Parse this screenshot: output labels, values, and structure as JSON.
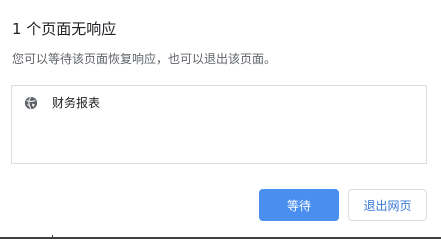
{
  "dialog": {
    "title": "1 个页面无响应",
    "message": "您可以等待该页面恢复响应，也可以退出该页面。",
    "pages": [
      {
        "icon": "globe-icon",
        "label": "财务报表"
      }
    ],
    "buttons": {
      "wait_label": "等待",
      "exit_label": "退出网页"
    },
    "colors": {
      "primary": "#4a8ef0",
      "link_text": "#3a78d6",
      "border": "#dadce0"
    }
  }
}
